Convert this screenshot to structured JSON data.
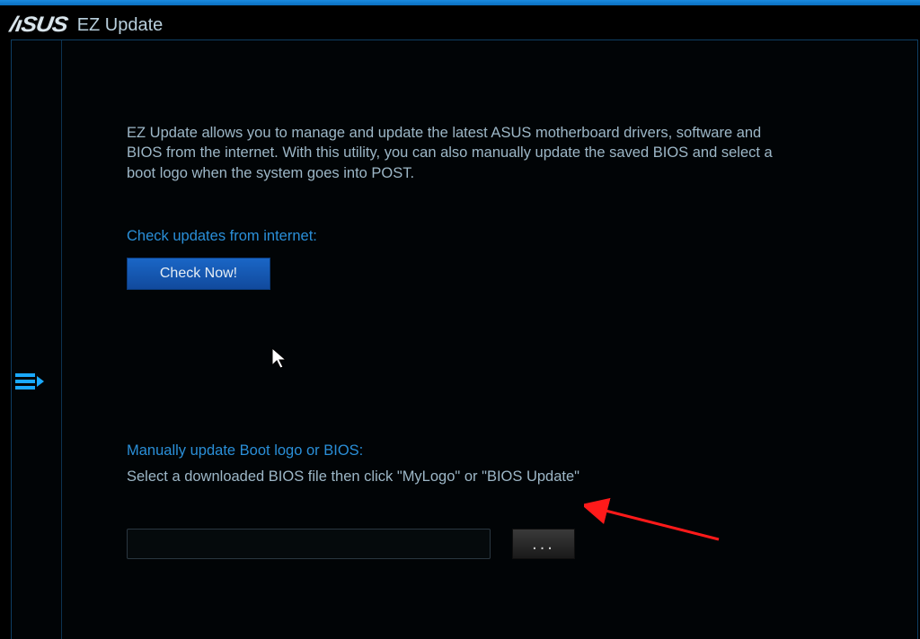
{
  "brand": "/ıSUS",
  "app_title": "EZ Update",
  "description": "EZ Update allows you to manage and update the latest ASUS motherboard drivers, software and BIOS from the internet. With this utility, you can also manually update the saved BIOS and select a boot logo when the system goes into POST.",
  "check_section": {
    "label": "Check updates from internet:",
    "button": "Check Now!"
  },
  "manual_section": {
    "label": "Manually update Boot logo or BIOS:",
    "instruction": "Select a downloaded BIOS file then click \"MyLogo\" or \"BIOS Update\"",
    "file_value": "",
    "browse_label": "..."
  },
  "colors": {
    "accent": "#1aa9ff",
    "button_blue": "#1457b0",
    "label_blue": "#2a8fd8"
  }
}
